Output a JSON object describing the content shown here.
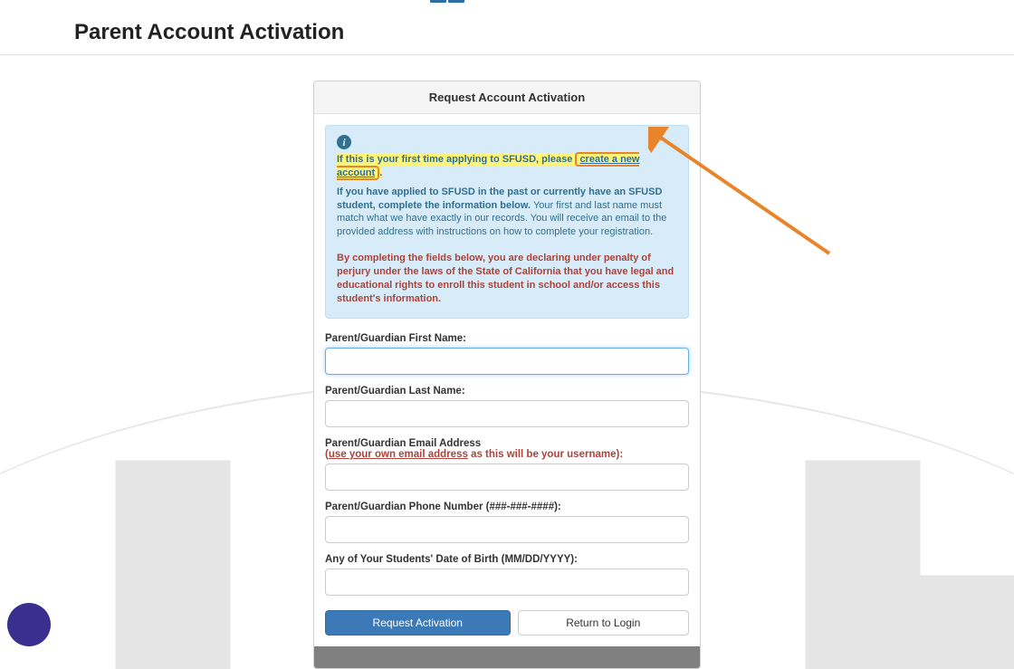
{
  "page": {
    "title": "Parent Account Activation"
  },
  "card": {
    "header": "Request Account Activation"
  },
  "info": {
    "line1_prefix": "If this is your first time applying to SFUSD, please ",
    "line1_link": "create a new account",
    "line1_suffix": ".",
    "line2_bold": "If you have applied to SFUSD in the past or currently have an SFUSD student, complete the information below.",
    "line2_rest": " Your first and last name must match what we have exactly in our records. You will receive an email to the provided address with instructions on how to complete your registration.",
    "line3": "By completing the fields below, you are declaring under penalty of perjury under the laws of the State of California that you have legal and educational rights to enroll this student in school and/or access this student's information."
  },
  "fields": {
    "first_name": {
      "label": "Parent/Guardian First Name:",
      "value": ""
    },
    "last_name": {
      "label": "Parent/Guardian Last Name:",
      "value": ""
    },
    "email": {
      "label": "Parent/Guardian Email Address",
      "hint_prefix": "(",
      "hint_underlined": "use your own email address",
      "hint_suffix": " as this will be your username):",
      "value": ""
    },
    "phone": {
      "label": "Parent/Guardian Phone Number (###-###-####):",
      "value": ""
    },
    "dob": {
      "label": "Any of Your Students' Date of Birth (MM/DD/YYYY):",
      "value": ""
    }
  },
  "buttons": {
    "request": "Request Activation",
    "return": "Return to Login"
  }
}
